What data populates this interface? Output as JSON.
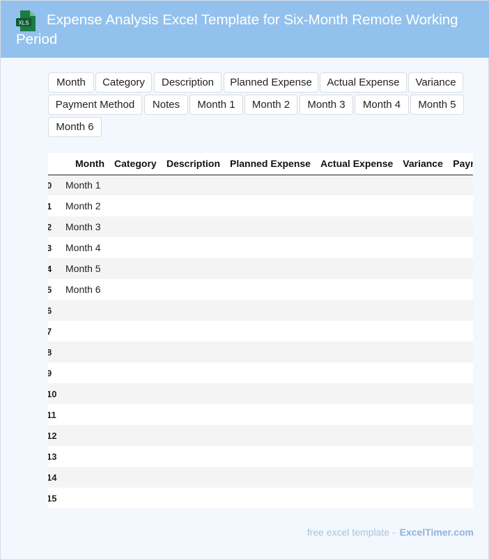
{
  "header": {
    "title": "Expense Analysis Excel Template for Six-Month Remote Working Period",
    "logo_text": "XLS"
  },
  "tags": [
    "Month",
    "Category",
    "Description",
    "Planned Expense",
    "Actual Expense",
    "Variance",
    "Payment Method",
    "Notes",
    "Month 1",
    "Month 2",
    "Month 3",
    "Month 4",
    "Month 5",
    "Month 6"
  ],
  "table": {
    "columns": [
      "",
      "Month",
      "Category",
      "Description",
      "Planned Expense",
      "Actual Expense",
      "Variance",
      "Payment Method"
    ],
    "rows": [
      {
        "index": "0",
        "month": "Month 1"
      },
      {
        "index": "1",
        "month": "Month 2"
      },
      {
        "index": "2",
        "month": "Month 3"
      },
      {
        "index": "3",
        "month": "Month 4"
      },
      {
        "index": "4",
        "month": "Month 5"
      },
      {
        "index": "5",
        "month": "Month 6"
      },
      {
        "index": "6",
        "month": ""
      },
      {
        "index": "7",
        "month": ""
      },
      {
        "index": "8",
        "month": ""
      },
      {
        "index": "9",
        "month": ""
      },
      {
        "index": "10",
        "month": ""
      },
      {
        "index": "11",
        "month": ""
      },
      {
        "index": "12",
        "month": ""
      },
      {
        "index": "13",
        "month": ""
      },
      {
        "index": "14",
        "month": ""
      },
      {
        "index": "15",
        "month": ""
      }
    ]
  },
  "footer": {
    "prefix": "free excel template -",
    "brand": "ExcelTimer.com"
  },
  "colors": {
    "header_bg": "#93c1ed",
    "page_bg": "#f3f8fe",
    "logo_green": "#1d7a45"
  }
}
